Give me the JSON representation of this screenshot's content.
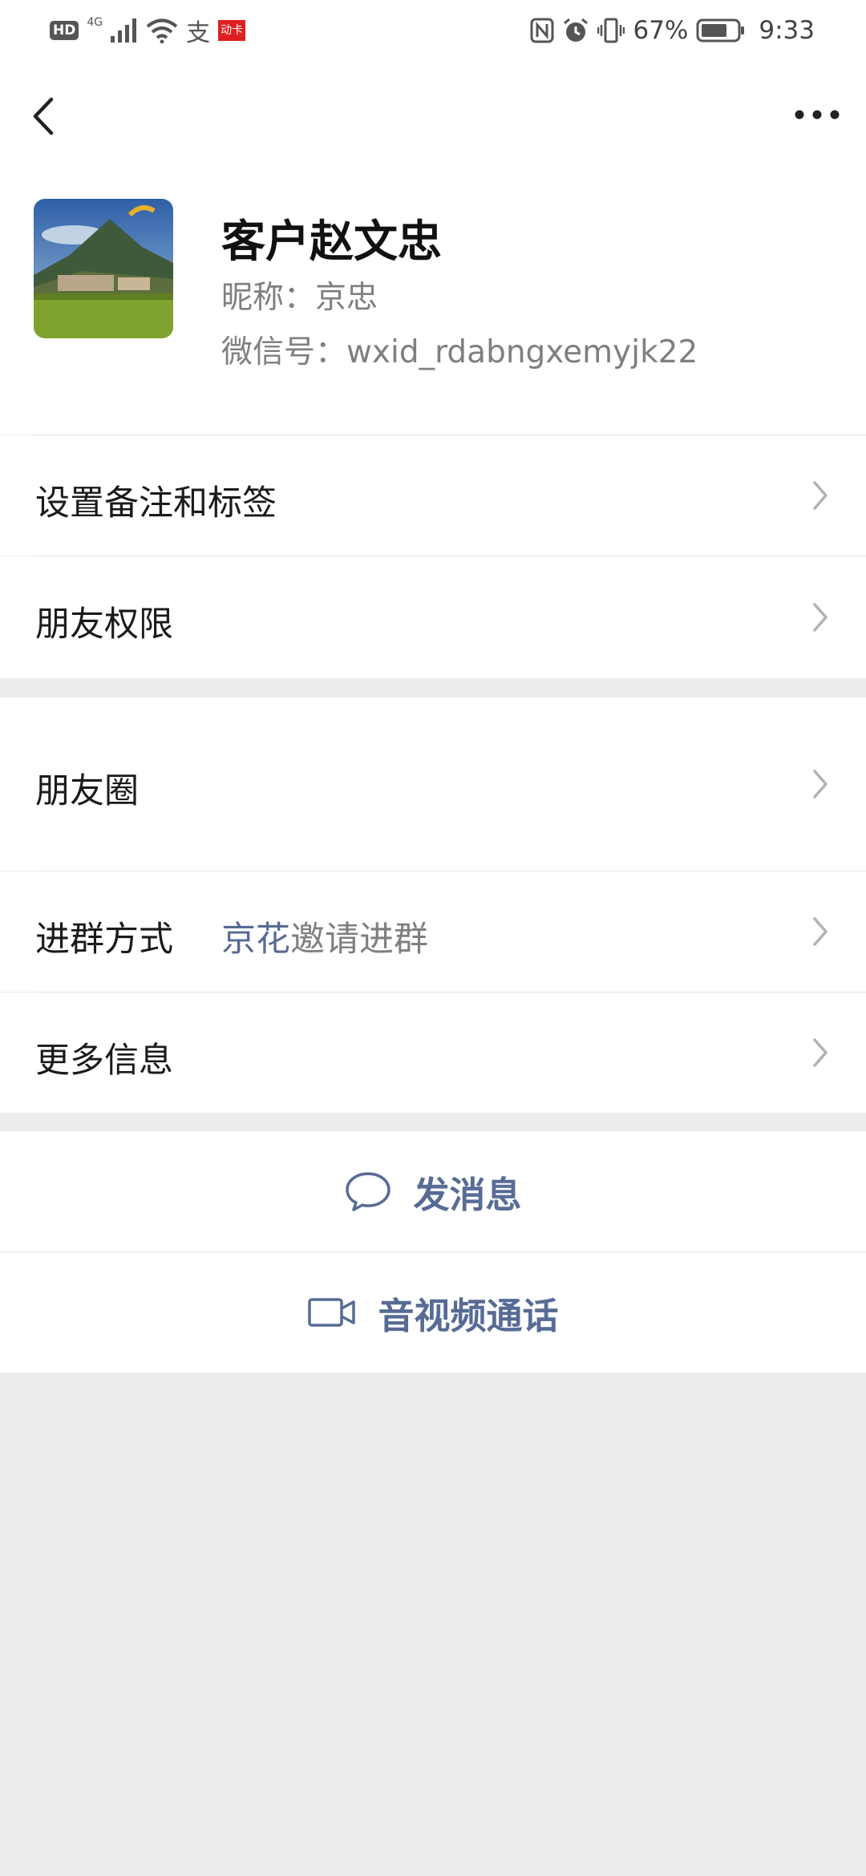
{
  "status_bar": {
    "hd": "HD",
    "network": "4G",
    "app_icon_text": "支",
    "red_badge": "动卡",
    "battery_percent": "67%",
    "time": "9:33"
  },
  "nav": {
    "back_icon": "chevron-left-icon",
    "more_icon": "more-dots-icon"
  },
  "profile": {
    "name": "客户赵文忠",
    "nickname": "昵称：京忠",
    "wechat_id": "微信号：wxid_rdabngxemyjk22"
  },
  "menu": {
    "remark_tags": "设置备注和标签",
    "friend_permissions": "朋友权限",
    "moments": "朋友圈",
    "join_method_label": "进群方式",
    "join_method_inviter": "京花",
    "join_method_suffix": "邀请进群",
    "more_info": "更多信息"
  },
  "actions": {
    "send_message": "发消息",
    "video_call": "音视频通话"
  },
  "colors": {
    "link_blue": "#576b95",
    "background_gray": "#ededed"
  }
}
